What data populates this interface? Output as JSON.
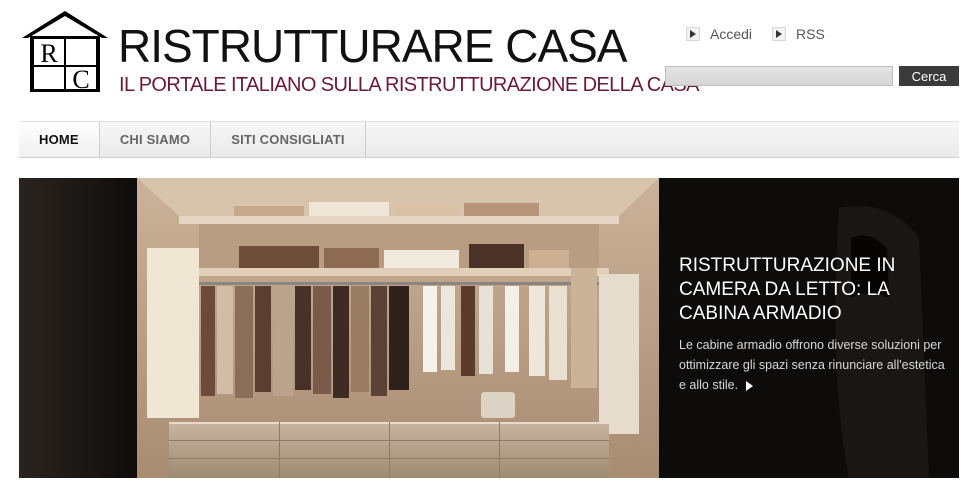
{
  "header": {
    "logo_letters": "RC",
    "title": "RISTRUTTURARE CASA",
    "tagline": "IL PORTALE ITALIANO SULLA RISTRUTTURAZIONE DELLA CASA"
  },
  "top_links": [
    {
      "label": "Accedi",
      "icon": "arrow-right-icon"
    },
    {
      "label": "RSS",
      "icon": "arrow-right-icon"
    }
  ],
  "search": {
    "value": "",
    "button_label": "Cerca"
  },
  "nav": {
    "items": [
      {
        "label": "HOME",
        "active": true
      },
      {
        "label": "CHI SIAMO",
        "active": false
      },
      {
        "label": "SITI CONSIGLIATI",
        "active": false
      }
    ]
  },
  "hero": {
    "title": "RISTRUTTURAZIONE IN CAMERA DA LETTO: LA CABINA ARMADIO",
    "text": "Le cabine armadio offrono diverse soluzioni per ottimizzare gli spazi senza rinunciare all'estetica e allo stile.",
    "more_icon": "play-arrow-icon"
  },
  "colors": {
    "tagline": "#6b1a3b",
    "search_button": "#3a3a3a",
    "hero_overlay": "rgba(0,0,0,0.45)"
  }
}
